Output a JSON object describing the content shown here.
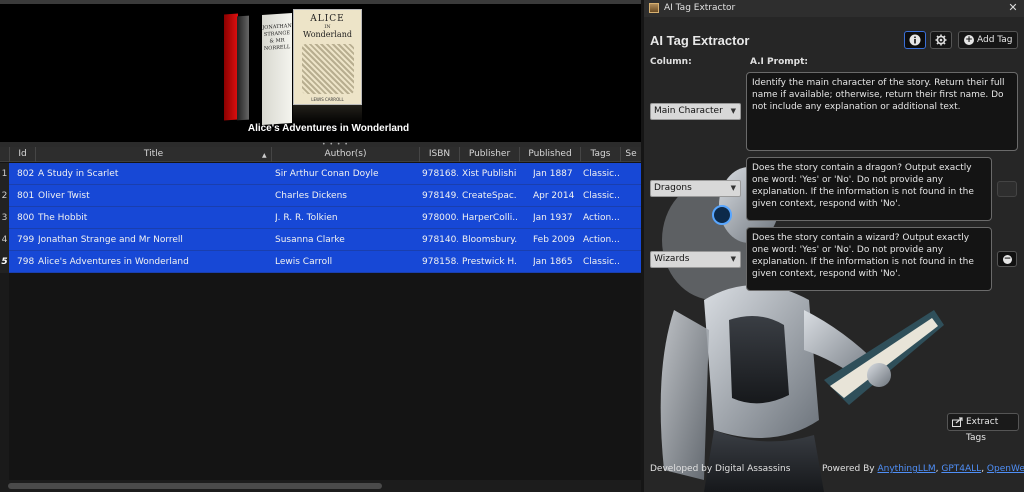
{
  "library": {
    "cover_title": "Alice's Adventures in Wonderland",
    "cover_alice": {
      "line1": "ALICE",
      "line2": "IN",
      "line3": "Wonderland",
      "author": "LEWIS CARROLL"
    },
    "cover_jsmn": "JONATHAN STRANGE & MR NORRELL",
    "columns": [
      "Id",
      "Title",
      "Author(s)",
      "ISBN",
      "Publisher",
      "Published",
      "Tags",
      "Se"
    ],
    "rows": [
      {
        "num": "1",
        "id": "802",
        "title": "A Study in Scarlet",
        "author": "Sir Arthur Conan Doyle",
        "isbn": "978168...",
        "publisher": "Xist Publishi...",
        "published": "Jan 1887",
        "tags": "Classic..."
      },
      {
        "num": "2",
        "id": "801",
        "title": "Oliver Twist",
        "author": "Charles Dickens",
        "isbn": "978149...",
        "publisher": "CreateSpac...",
        "published": "Apr 2014",
        "tags": "Classic..."
      },
      {
        "num": "3",
        "id": "800",
        "title": "The Hobbit",
        "author": "J. R. R. Tolkien",
        "isbn": "978000...",
        "publisher": "HarperColli...",
        "published": "Jan 1937",
        "tags": "Action..."
      },
      {
        "num": "4",
        "id": "799",
        "title": "Jonathan Strange and Mr Norrell",
        "author": "Susanna Clarke",
        "isbn": "978140...",
        "publisher": "Bloomsbury...",
        "published": "Feb 2009",
        "tags": "Action..."
      },
      {
        "num": "5",
        "id": "798",
        "title": "Alice's Adventures in Wonderland",
        "author": "Lewis Carroll",
        "isbn": "978158...",
        "publisher": "Prestwick H...",
        "published": "Jan 1865",
        "tags": "Classic..."
      }
    ]
  },
  "extractor": {
    "window_title": "AI Tag Extractor",
    "close_glyph": "✕",
    "panel_title": "AI Tag Extractor",
    "add_tag_label": "Add Tag",
    "column_label": "Column:",
    "prompt_label": "A.I Prompt:",
    "tags": [
      {
        "column": "Main Character",
        "prompt": "Identify the main character of the story. Return their full name if available; otherwise, return their first name. Do not include any explanation or additional text."
      },
      {
        "column": "Dragons",
        "prompt": "Does the story contain a dragon? Output exactly one word: 'Yes' or 'No'. Do not provide any explanation. If the information is not found in the given context, respond with 'No'."
      },
      {
        "column": "Wizards",
        "prompt": "Does the story contain a wizard? Output exactly one word: 'Yes' or 'No'. Do not provide any explanation. If the information is not found in the given context, respond with 'No'."
      }
    ],
    "extract_label": "Extract Tags",
    "footer_left": "Developed by Digital Assassins",
    "footer_powered": "Powered By ",
    "links": [
      "AnythingLLM",
      "GPT4ALL",
      "OpenWebUI"
    ],
    "link_sep": ", ",
    "icons": {
      "info": "info-icon",
      "settings": "gear-icon",
      "add": "plus-circle-icon",
      "remove": "minus-circle-icon",
      "extract": "export-icon",
      "close": "close-icon",
      "app": "book-icon"
    },
    "colors": {
      "selection": "#1748d6",
      "link": "#4f8ff7",
      "panel_bg": "#262626"
    }
  }
}
